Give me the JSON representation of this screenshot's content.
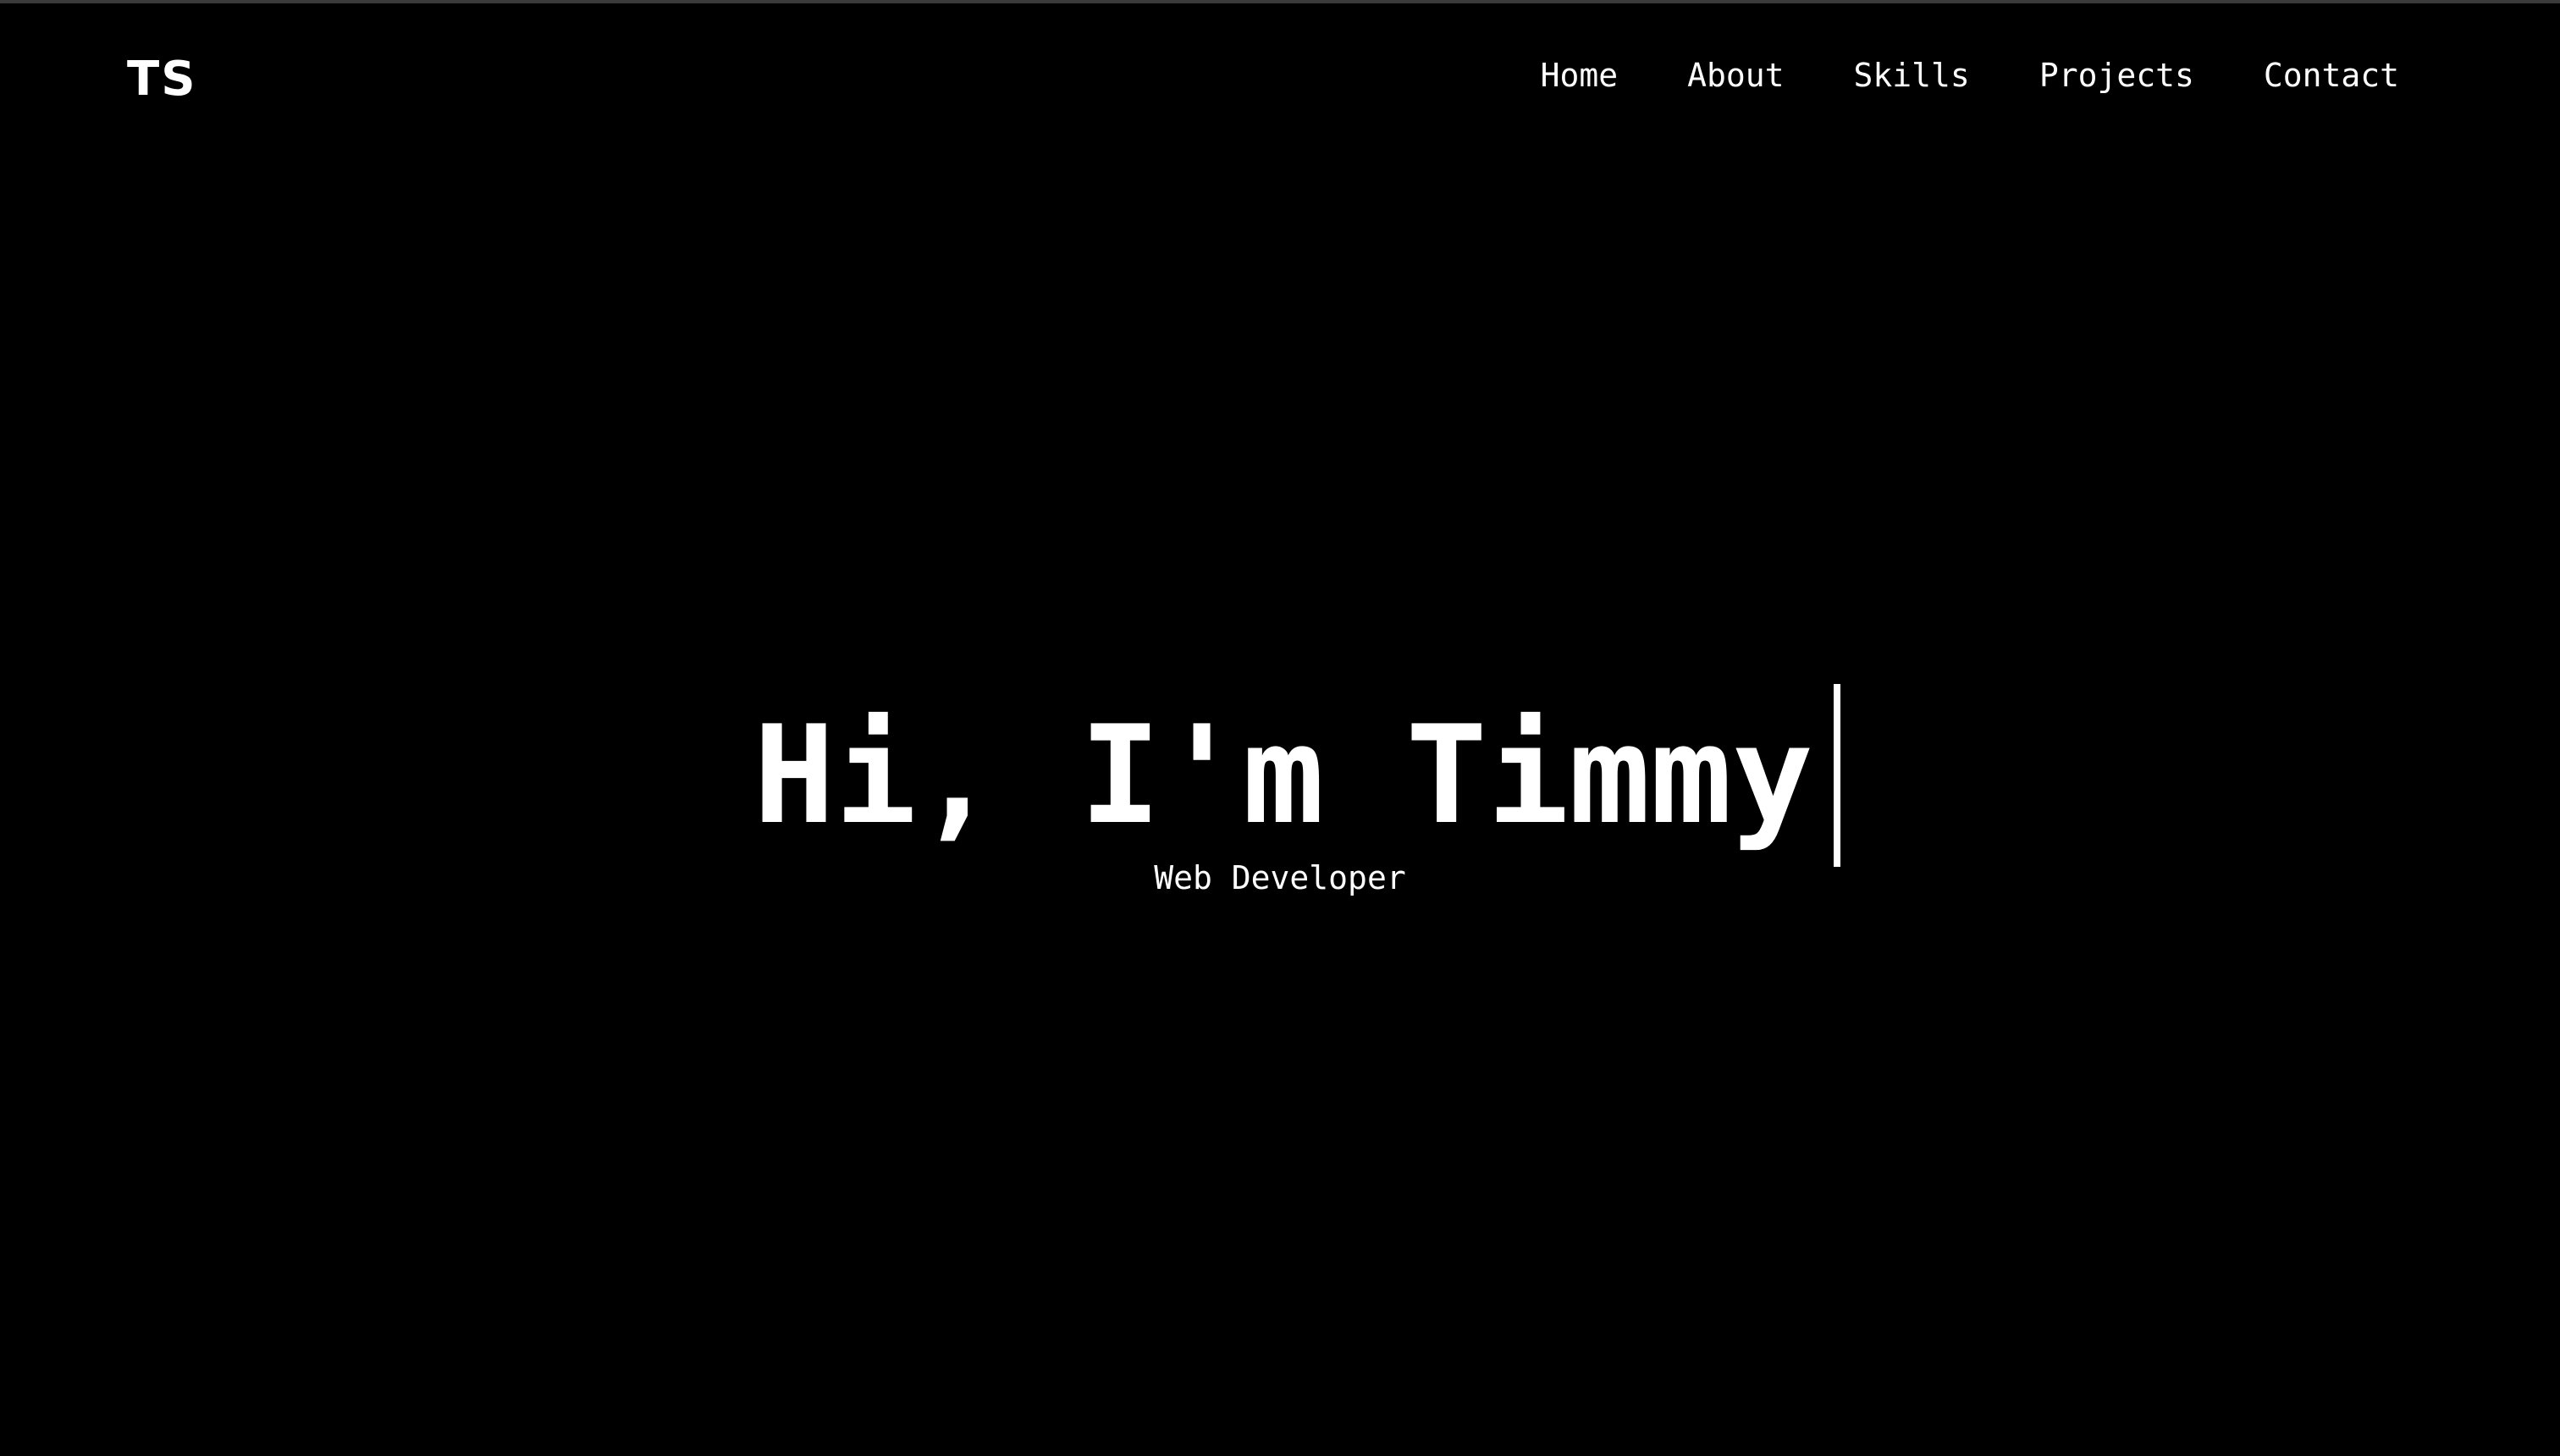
{
  "header": {
    "logo": "TS",
    "nav": [
      {
        "label": "Home"
      },
      {
        "label": "About"
      },
      {
        "label": "Skills"
      },
      {
        "label": "Projects"
      },
      {
        "label": "Contact"
      }
    ]
  },
  "hero": {
    "title": "Hi, I'm Timmy",
    "subtitle": "Web Developer"
  },
  "colors": {
    "background": "#000000",
    "text": "#ffffff"
  }
}
